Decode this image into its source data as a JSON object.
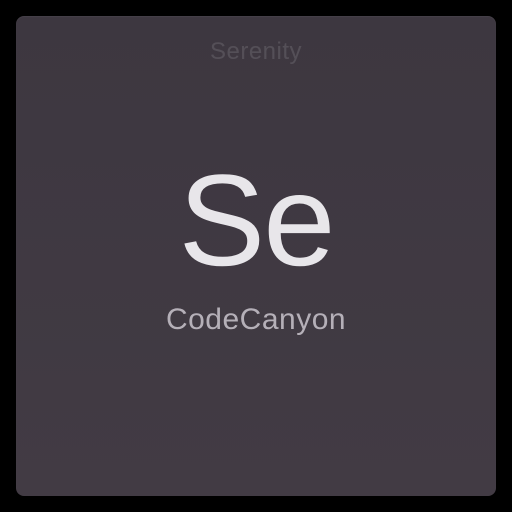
{
  "tile": {
    "header": "Serenity",
    "symbol": "Se",
    "subtitle": "CodeCanyon"
  }
}
